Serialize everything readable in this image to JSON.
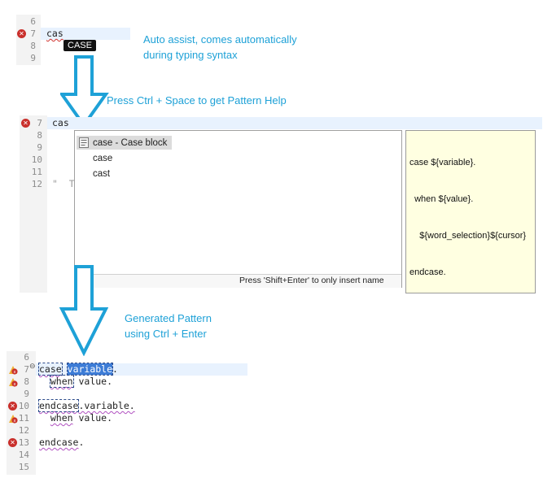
{
  "section1": {
    "line_numbers": [
      "6",
      "7",
      "8",
      "9"
    ],
    "code_line": "cas",
    "assist_badge": "CASE",
    "note": [
      "Auto assist, comes automatically",
      "during typing syntax"
    ]
  },
  "arrow1_label": "Press Ctrl + Space to get Pattern Help",
  "section2": {
    "line_numbers": [
      "7",
      "8",
      "9",
      "10",
      "11",
      "12"
    ],
    "code_line": "cas",
    "faded_line": "\"  T",
    "proposals": [
      "case - Case block",
      "case",
      "cast"
    ],
    "footer": "Press 'Shift+Enter' to only insert name",
    "tooltip": [
      "case ${variable}.",
      "  when ${value}.",
      "    ${word_selection}${cursor}",
      "endcase."
    ]
  },
  "arrow2_label": [
    "Generated Pattern",
    "using Ctrl + Enter"
  ],
  "section3": {
    "line_numbers": [
      "6",
      "7",
      "8",
      "9",
      "10",
      "11",
      "12",
      "13",
      "14",
      "15"
    ],
    "lines": {
      "l7_kw": "case",
      "l7_sel": "variable",
      "l7_tail": ".",
      "l8_kw": "when",
      "l8_tail": " value.",
      "l10_kw": "endcase",
      "l10_tail": ".variable.",
      "l11_kw": "when",
      "l11_tail": " value.",
      "l13_kw": "endcase",
      "l13_tail": "."
    }
  },
  "colors": {
    "note": "#1ea1d7",
    "arrow": "#1ea1d7",
    "selection": "#3d7cd6",
    "error": "#c9302c"
  }
}
